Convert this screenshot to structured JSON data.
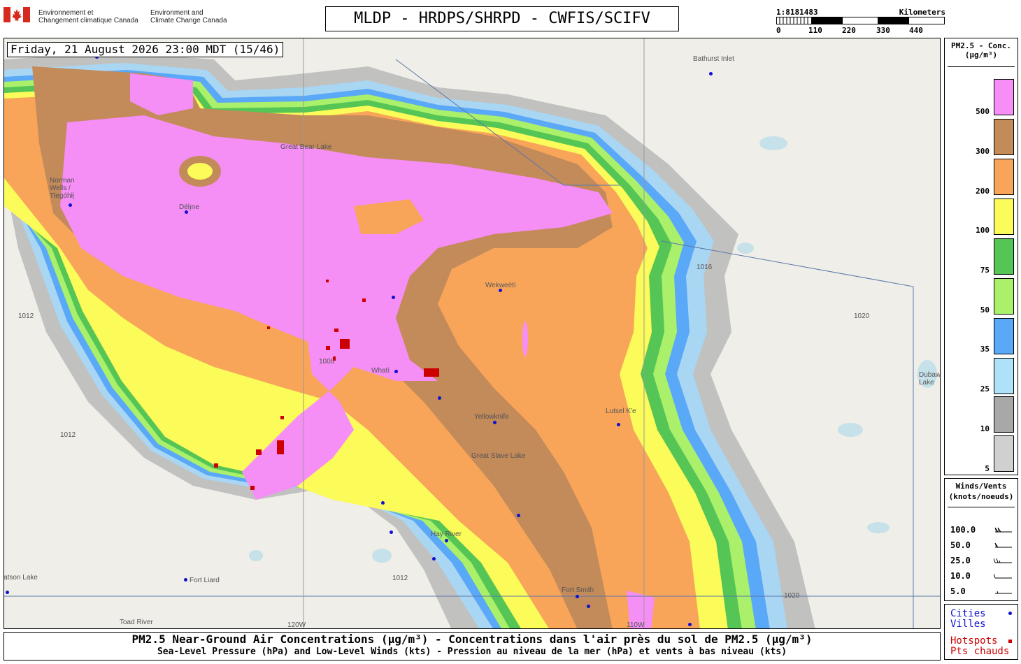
{
  "header": {
    "title": "MLDP - HRDPS/SHRPD - CWFIS/SCIFV",
    "gov_fr_line1": "Environnement et",
    "gov_fr_line2": "Changement climatique Canada",
    "gov_en_line1": "Environment and",
    "gov_en_line2": "Climate Change Canada"
  },
  "scale": {
    "ratio": "1:8181483",
    "unit": "Kilometers",
    "ticks": [
      "0",
      "110",
      "220",
      "330",
      "440"
    ]
  },
  "map": {
    "timestamp": "Friday, 21 August 2026 23:00 MDT (15/46)",
    "places": [
      {
        "name": "Bathurst Inlet"
      },
      {
        "name": "Norman Wells / Tłegóhłį"
      },
      {
        "name": "Délı̨ne"
      },
      {
        "name": "Great Bear Lake"
      },
      {
        "name": "Wekweètì"
      },
      {
        "name": "Whatì"
      },
      {
        "name": "Yellowknife"
      },
      {
        "name": "Great Slave Lake"
      },
      {
        "name": "Lutsel K'e"
      },
      {
        "name": "Hay River"
      },
      {
        "name": "Fort Liard"
      },
      {
        "name": "Fort Smith"
      },
      {
        "name": "Toad River"
      },
      {
        "name": "Dubawnt Lake"
      },
      {
        "name": "Watson Lake"
      }
    ],
    "isobars": [
      "1008",
      "1012",
      "1016",
      "1020"
    ],
    "longitudes": [
      "120W",
      "110W"
    ]
  },
  "pm25_legend": {
    "title_line1": "PM2.5 - Conc.",
    "title_line2": "(μg/m³)",
    "levels": [
      {
        "label": "500",
        "color": "#f58ef5"
      },
      {
        "label": "300",
        "color": "#c38a5a"
      },
      {
        "label": "200",
        "color": "#f8a55a"
      },
      {
        "label": "100",
        "color": "#fbfb5a"
      },
      {
        "label": "75",
        "color": "#55c555"
      },
      {
        "label": "50",
        "color": "#aaf06a"
      },
      {
        "label": "35",
        "color": "#5aa8f8"
      },
      {
        "label": "25",
        "color": "#aee2f8"
      },
      {
        "label": "10",
        "color": "#a8a8a8"
      },
      {
        "label": "5",
        "color": "#d0d0d0"
      }
    ]
  },
  "wind_legend": {
    "title_line1": "Winds/Vents",
    "title_line2": "(knots/noeuds)",
    "rows": [
      "100.0",
      "50.0",
      "25.0",
      "10.0",
      "5.0"
    ]
  },
  "cities_legend": {
    "cities_en": "Cities",
    "cities_fr": "Villes",
    "hotspots_en": "Hotspots",
    "hotspots_fr": "Pts chauds",
    "city_color": "#1010d0",
    "hotspot_color": "#cc0000"
  },
  "footer": {
    "line1": "PM2.5 Near-Ground Air Concentrations (μg/m³) - Concentrations dans l'air près du sol de PM2.5 (μg/m³)",
    "line2": "Sea-Level Pressure (hPa) and Low-Level Winds (kts) - Pression au niveau de la mer (hPa) et vents à bas niveau (kts)"
  }
}
